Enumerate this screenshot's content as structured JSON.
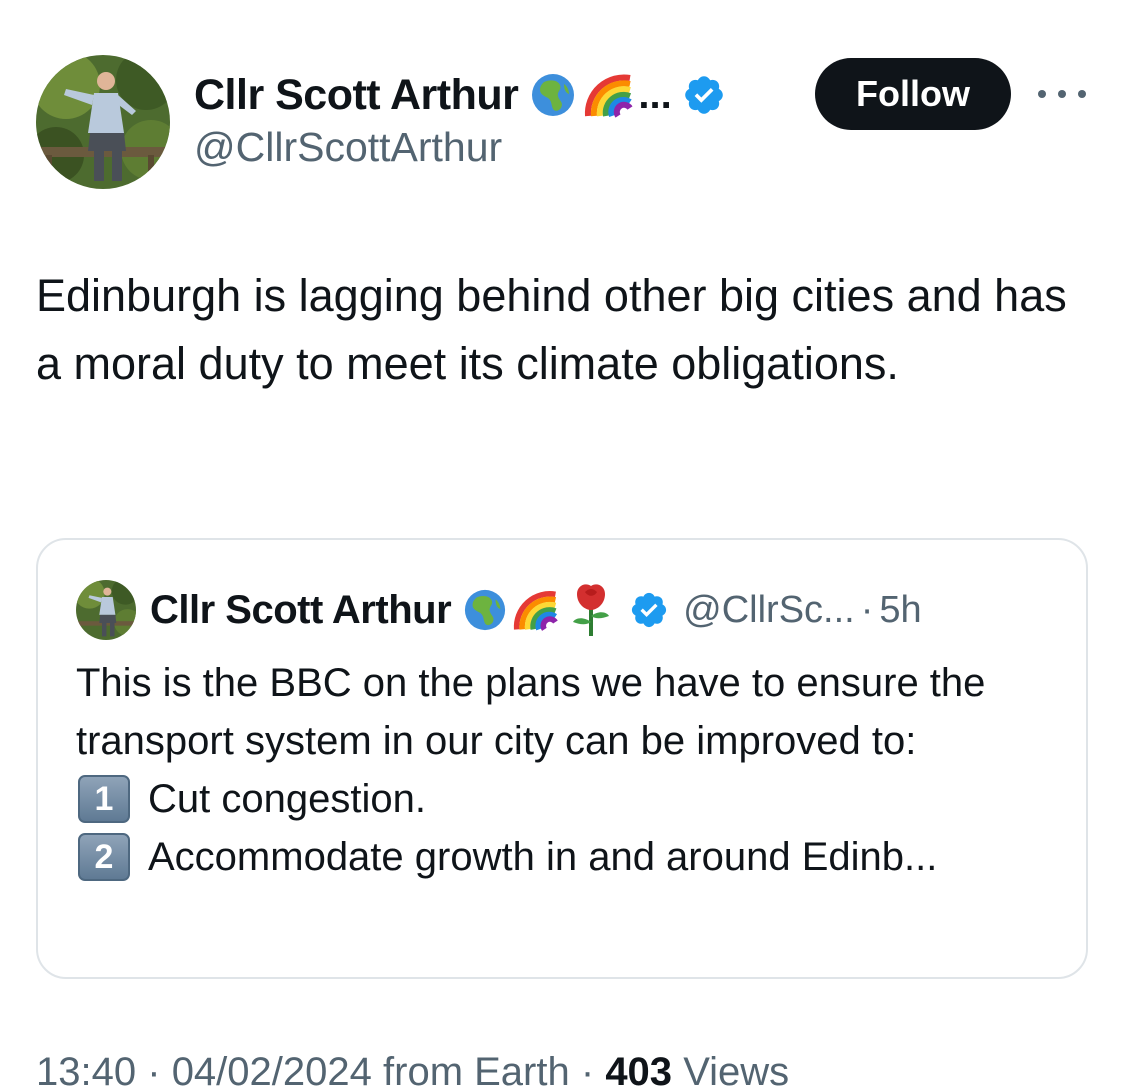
{
  "author": {
    "display_name": "Cllr Scott Arthur",
    "handle": "@CllrScottArthur",
    "name_emojis": [
      "globe-africa-emoji",
      "rainbow-emoji"
    ],
    "name_truncation": "..."
  },
  "actions": {
    "follow_label": "Follow"
  },
  "tweet": {
    "text": "Edinburgh is lagging behind other big cities and has a moral duty to meet its climate obligations."
  },
  "quote": {
    "display_name": "Cllr Scott Arthur",
    "handle": "@CllrSc...",
    "separator": "·",
    "time": "5h",
    "name_emojis": [
      "globe-africa-emoji",
      "rainbow-emoji",
      "rose-emoji"
    ],
    "text_intro": "This is the BBC on the plans we have to ensure the transport system in our city can be improved to:",
    "items": [
      {
        "number": "1",
        "text": "Cut congestion."
      },
      {
        "number": "2",
        "text": "Accommodate growth in and around Edinb..."
      }
    ]
  },
  "meta": {
    "time": "13:40",
    "date": "04/02/2024",
    "source": "from Earth",
    "separator": "·",
    "views_count": "403",
    "views_label": "Views"
  },
  "colors": {
    "text_primary": "#0f1419",
    "text_secondary": "#536471",
    "verified_blue": "#1d9bf0",
    "border": "#dfe4e8",
    "follow_bg": "#0f1419"
  }
}
